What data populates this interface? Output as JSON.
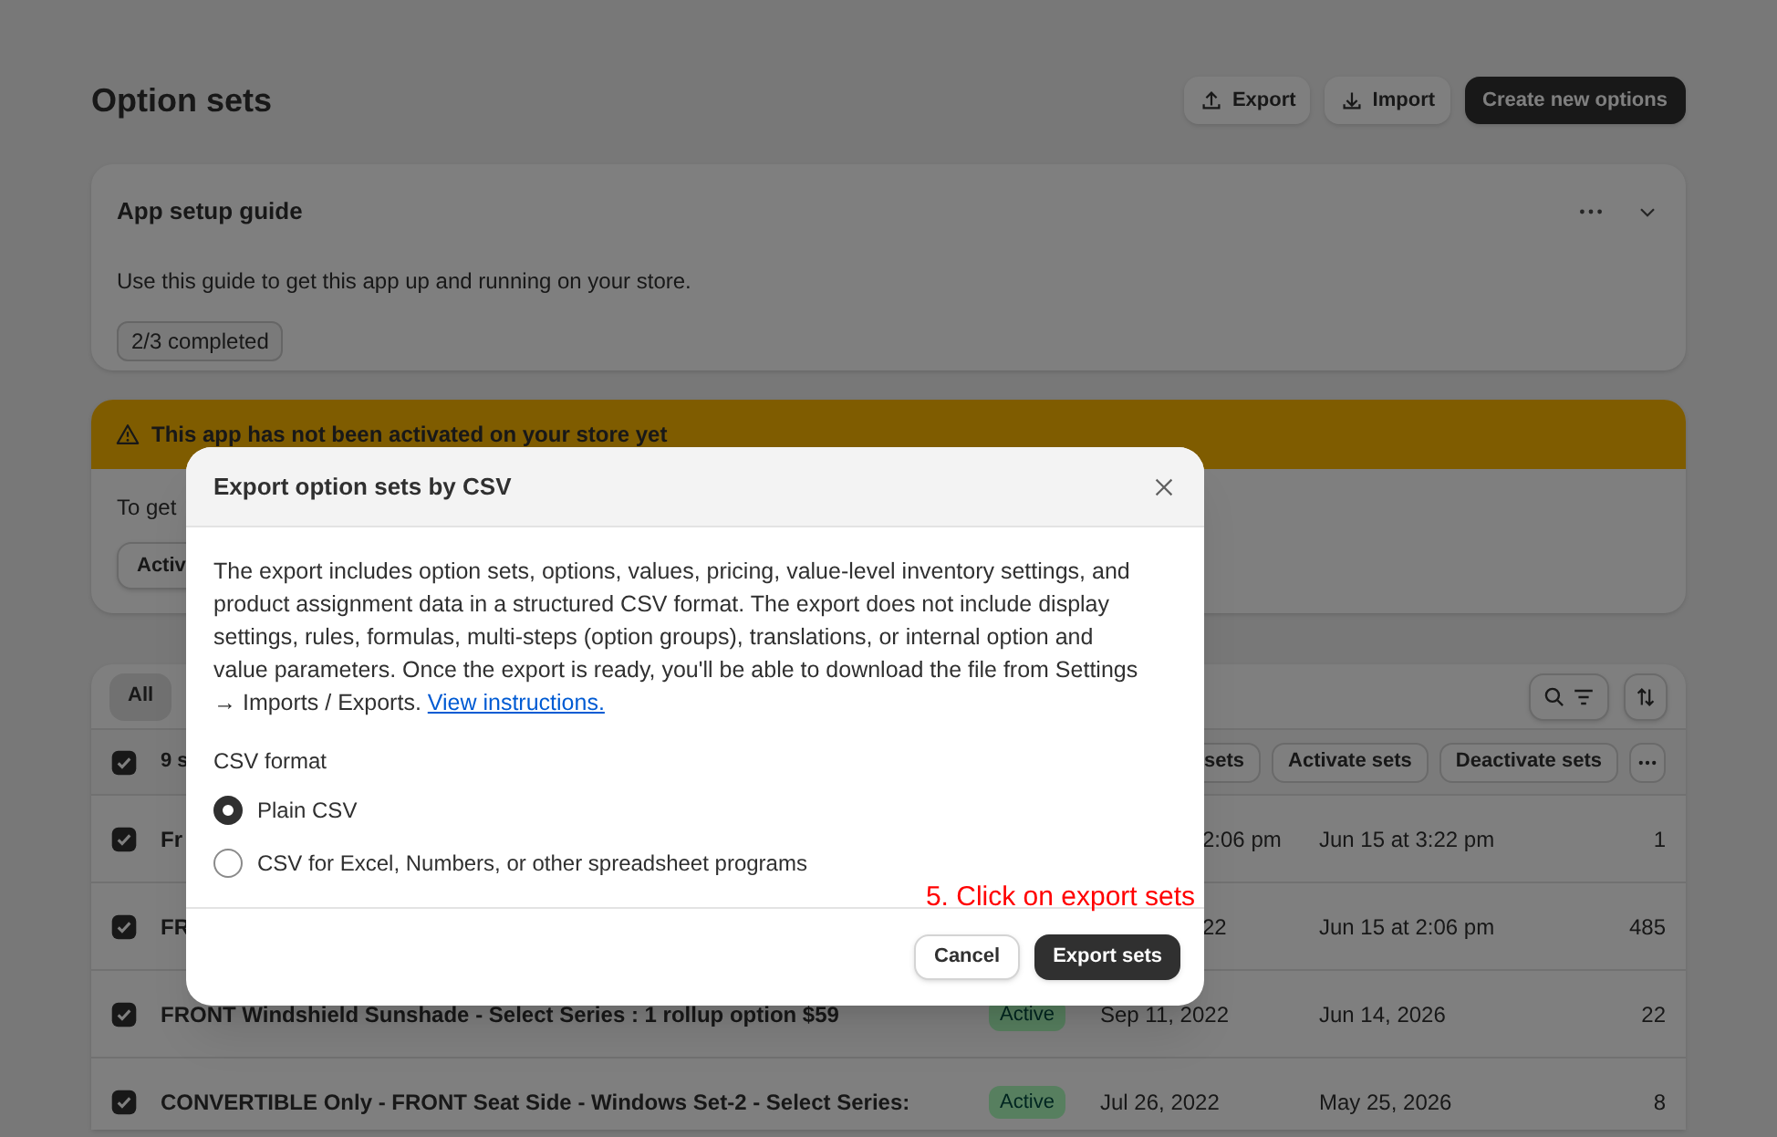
{
  "page": {
    "title": "Option sets",
    "actions": [
      {
        "kind": "export",
        "label": "Export"
      },
      {
        "kind": "import",
        "label": "Import"
      },
      {
        "kind": "primary",
        "label": "Create new options"
      }
    ]
  },
  "setup_guide": {
    "title": "App setup guide",
    "description": "Use this guide to get this app up and running on your store.",
    "progress": "2/3 completed"
  },
  "banner": {
    "title": "This app has not been activated on your store yet",
    "text": "To get",
    "button": "Activ"
  },
  "table": {
    "tabs": [
      {
        "label": "All",
        "selected": true
      }
    ],
    "bulk": {
      "checked": true,
      "count": "9 s",
      "actions": [
        "sets",
        "Activate sets",
        "Deactivate sets"
      ]
    },
    "rows": [
      {
        "checked": true,
        "name": "Fr",
        "created": "2:06 pm",
        "updated": "Jun 15 at 3:22 pm",
        "count": "1"
      },
      {
        "checked": true,
        "name": "FR",
        "created": "22",
        "updated": "Jun 15 at 2:06 pm",
        "count": "485"
      },
      {
        "checked": true,
        "name": "FRONT Windshield Sunshade - Select Series : 1 rollup option $59",
        "status": "Active",
        "created": "Sep 11, 2022",
        "updated": "Jun 14, 2026",
        "count": "22"
      },
      {
        "checked": true,
        "name": "CONVERTIBLE Only - FRONT Seat Side - Windows Set-2 - Select Series:",
        "status": "Active",
        "created": "Jul 26, 2022",
        "updated": "May 25, 2026",
        "count": "8"
      }
    ]
  },
  "modal": {
    "title": "Export option sets by CSV",
    "body": "The export includes option sets, options, values, pricing, value-level inventory settings, and product assignment data in a structured CSV format. The export does not include display settings, rules, formulas, multi-steps (option groups), translations, or internal option and value parameters. Once the export is ready, you'll be able to download the file from Settings → Imports / Exports.",
    "link": "View instructions.",
    "format_label": "CSV format",
    "options": [
      {
        "label": "Plain CSV",
        "selected": true
      },
      {
        "label": "CSV for Excel, Numbers, or other spreadsheet programs",
        "selected": false
      }
    ],
    "buttons": [
      {
        "kind": "secondary",
        "label": "Cancel"
      },
      {
        "kind": "primary",
        "label": "Export sets"
      }
    ],
    "annotation": "5. Click on export sets"
  }
}
